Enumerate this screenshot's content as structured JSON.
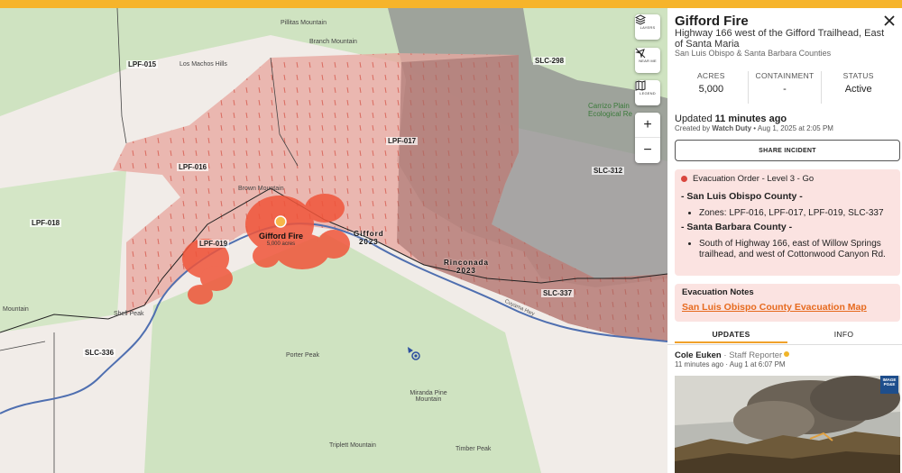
{
  "map": {
    "zones": [
      "LPF-015",
      "LPF-017",
      "LPF-016",
      "LPF-018",
      "LPF-019",
      "SLC-298",
      "SLC-312",
      "SLC-337",
      "SLC-336"
    ],
    "places": [
      "Pillitas Mountain",
      "Branch Mountain",
      "Los Machos Hills",
      "Shell Peak",
      "Porter Peak",
      "Miranda Pine Mountain",
      "Triplett Mountain",
      "Timber Peak",
      "Brown Mountain",
      "Mountain"
    ],
    "park_label_1": "Carrizo Plain",
    "park_label_2": "Ecological Re",
    "road_label": "Cuyama Hwy",
    "fire_label": "Gifford Fire",
    "fire_sublabel": "5,000 acres",
    "prev_fire_1_name": "Gifford",
    "prev_fire_1_year": "2023",
    "prev_fire_2_name": "Rinconada",
    "prev_fire_2_year": "2023",
    "controls": {
      "layers_label": "LAYERS",
      "near_me_label": "NEAR ME",
      "legend_label": "LEGEND",
      "zoom_in": "+",
      "zoom_out": "−"
    },
    "colors": {
      "evac_zone": "#e8a8a0",
      "fire": "#f0553a",
      "accent": "#f6b42b"
    }
  },
  "panel": {
    "title": "Gifford Fire",
    "subtitle": "Highway 166 west of the Gifford Trailhead, East of Santa Maria",
    "counties": "San Luis Obispo & Santa Barbara Counties",
    "stats": [
      {
        "label": "ACRES",
        "value": "5,000"
      },
      {
        "label": "CONTAINMENT",
        "value": "-"
      },
      {
        "label": "STATUS",
        "value": "Active"
      }
    ],
    "updated_prefix": "Updated",
    "updated_time": "11 minutes ago",
    "created_prefix": "Created by",
    "created_by": "Watch Duty",
    "created_date": " • Aug 1, 2025 at 2:05 PM",
    "share_label": "SHARE INCIDENT",
    "evacuation": {
      "header": "Evacuation Order - Level 3 - Go",
      "county_1": "- San Luis Obispo County -",
      "county_1_item": "Zones: LPF-016, LPF-017, LPF-019, SLC-337",
      "county_2": "- Santa Barbara County -",
      "county_2_item": "South of Highway 166, east of Willow Springs trailhead, and west of Cottonwood Canyon Rd."
    },
    "notes": {
      "header": "Evacuation Notes",
      "link": "San Luis Obispo County Evacuation Map"
    },
    "tabs": [
      "UPDATES",
      "INFO"
    ],
    "update": {
      "author": "Cole Euken",
      "role": " · Staff Reporter",
      "time": "11 minutes ago · Aug 1 at 6:07 PM",
      "badge": "IMAGE PG&E"
    }
  }
}
